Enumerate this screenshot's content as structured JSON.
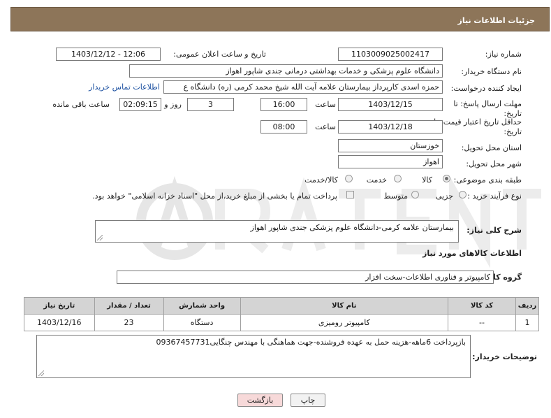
{
  "header": {
    "title": "جزئیات اطلاعات نیاز"
  },
  "form": {
    "need_number_label": "شماره نیاز:",
    "need_number_value": "1103009025002417",
    "announce_label": "تاریخ و ساعت اعلان عمومی:",
    "announce_value": "1403/12/12 - 12:06",
    "buyer_org_label": "نام دستگاه خریدار:",
    "buyer_org_value": "دانشگاه علوم پزشکی و خدمات بهداشتی درمانی جندی شاپور اهواز",
    "creator_label": "ایجاد کننده درخواست:",
    "creator_value": "حمزه اسدی کارپرداز بیمارستان علامه آیت الله شیخ محمد کرمی (ره) دانشگاه ع",
    "contact_link": "اطلاعات تماس خریدار",
    "deadline_label": "مهلت ارسال پاسخ: تا تاریخ:",
    "deadline_date": "1403/12/15",
    "time_label": "ساعت",
    "deadline_time": "16:00",
    "days_value": "3",
    "days_label": "روز و",
    "remaining_value": "02:09:15",
    "remaining_label": "ساعت باقی مانده",
    "validity_label": "حداقل تاریخ اعتبار قیمت: تا تاریخ:",
    "validity_date": "1403/12/18",
    "validity_time": "08:00",
    "province_label": "استان محل تحویل:",
    "province_value": "خوزستان",
    "city_label": "شهر محل تحویل:",
    "city_value": "اهواز",
    "category_label": "طبقه بندی موضوعی:",
    "category_options": [
      "کالا",
      "خدمت",
      "کالا/خدمت"
    ],
    "category_selected": "کالا",
    "process_label": "نوع فرآیند خرید :",
    "process_options": [
      "جزیی",
      "متوسط"
    ],
    "process_selected": "",
    "payment_note": "پرداخت تمام یا بخشی از مبلغ خرید،از محل \"اسناد خزانه اسلامی\" خواهد بود."
  },
  "description": {
    "label": "شرح کلی نیاز:",
    "value": "بیمارستان علامه کرمی-دانشگاه علوم پزشکی جندی شاپور اهواز"
  },
  "goods": {
    "section_title": "اطلاعات کالاهای مورد نیاز",
    "group_label": "گروه کالا:",
    "group_value": "کامپیوتر و فناوری اطلاعات-سخت افزار",
    "columns": [
      "ردیف",
      "کد کالا",
      "نام کالا",
      "واحد شمارش",
      "تعداد / مقدار",
      "تاریخ نیاز"
    ],
    "rows": [
      {
        "index": "1",
        "code": "--",
        "name": "کامپیوتر رومیزی",
        "unit": "دستگاه",
        "qty": "23",
        "date": "1403/12/16"
      }
    ]
  },
  "buyer_notes": {
    "label": "توضیحات خریدار:",
    "value": "بازپرداخت 6ماهه-هزینه حمل به عهده فروشنده-جهت هماهنگی با مهندس چنگایی09367457731"
  },
  "buttons": {
    "print": "چاپ",
    "back": "بازگشت"
  },
  "colors": {
    "header_bg": "#8d7559",
    "back_button_bg": "#f7d9d9",
    "link": "#1a4fa0"
  }
}
